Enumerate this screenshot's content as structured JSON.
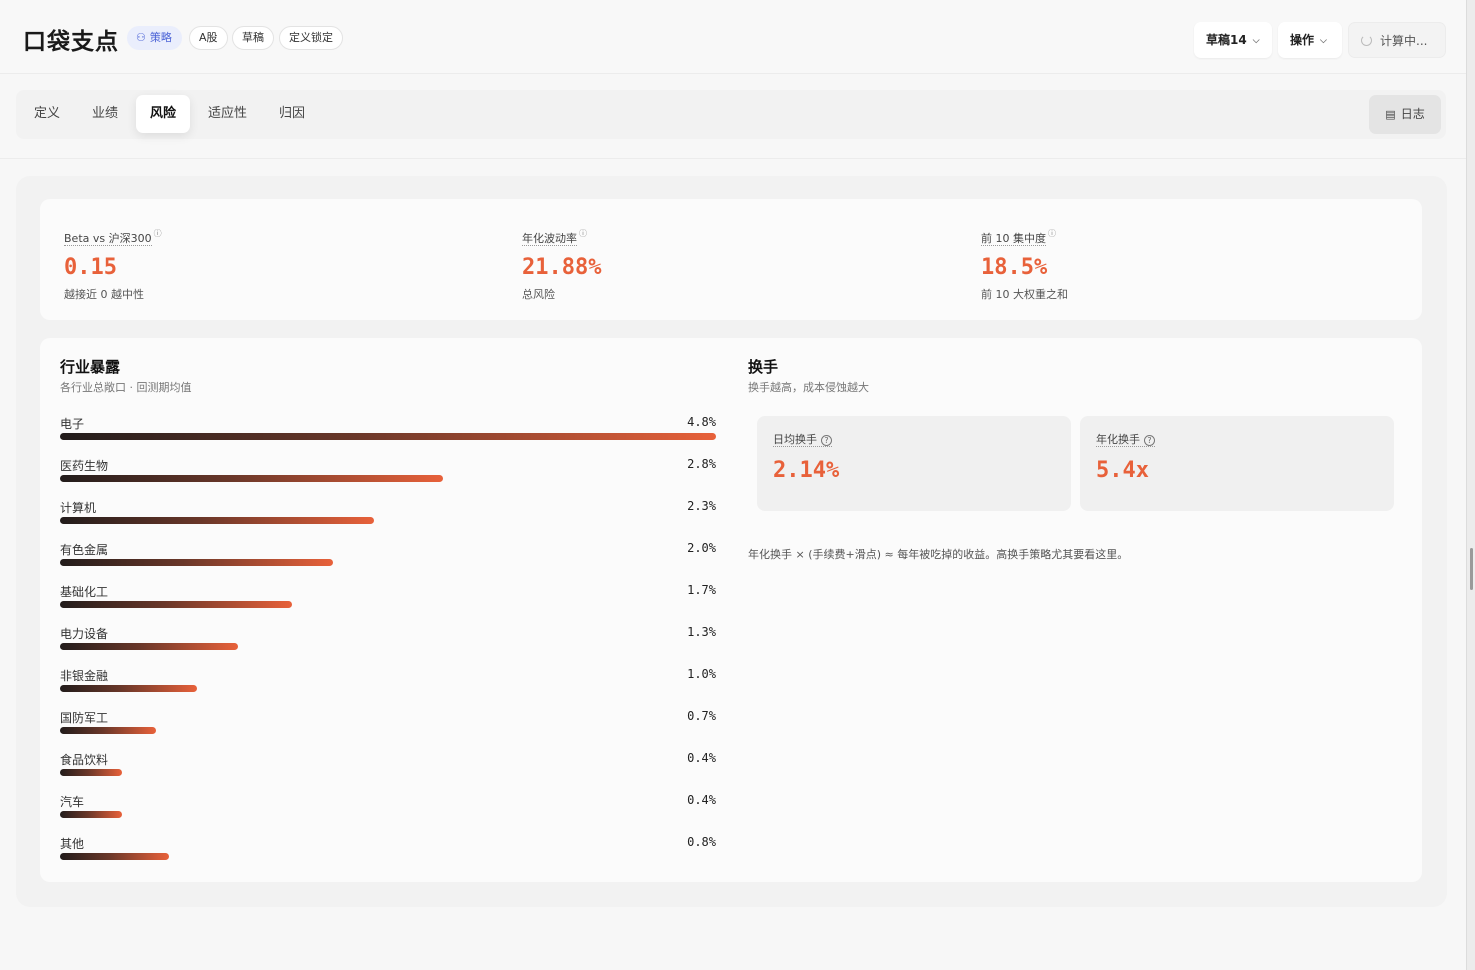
{
  "header": {
    "app_title": "口袋支点",
    "chips": [
      {
        "label": "策略",
        "icon": "strategy-icon"
      },
      {
        "label": "A股"
      },
      {
        "label": "草稿"
      },
      {
        "label": "定义锁定"
      }
    ],
    "draft_select": "草稿14",
    "actions_label": "操作",
    "status_label": "计算中..."
  },
  "tabs": [
    {
      "label": "定义",
      "active": false
    },
    {
      "label": "业绩",
      "active": false
    },
    {
      "label": "风险",
      "active": true
    },
    {
      "label": "适应性",
      "active": false
    },
    {
      "label": "归因",
      "active": false
    }
  ],
  "log_button": "日志",
  "metrics": [
    {
      "label": "Beta vs 沪深300",
      "value": "0.15",
      "sub": "越接近 0 越中性"
    },
    {
      "label": "年化波动率",
      "value": "21.88%",
      "sub": "总风险"
    },
    {
      "label": "前 10 集中度",
      "value": "18.5%",
      "sub": "前 10 大权重之和"
    }
  ],
  "industry": {
    "title": "行业暴露",
    "subtitle": "各行业总敞口 · 回测期均值",
    "max_value": 4.8,
    "items": [
      {
        "name": "电子",
        "value": 4.8,
        "label": "4.8%"
      },
      {
        "name": "医药生物",
        "value": 2.8,
        "label": "2.8%"
      },
      {
        "name": "计算机",
        "value": 2.3,
        "label": "2.3%"
      },
      {
        "name": "有色金属",
        "value": 2.0,
        "label": "2.0%"
      },
      {
        "name": "基础化工",
        "value": 1.7,
        "label": "1.7%"
      },
      {
        "name": "电力设备",
        "value": 1.3,
        "label": "1.3%"
      },
      {
        "name": "非银金融",
        "value": 1.0,
        "label": "1.0%"
      },
      {
        "name": "国防军工",
        "value": 0.7,
        "label": "0.7%"
      },
      {
        "name": "食品饮料",
        "value": 0.4,
        "label": "0.4%"
      },
      {
        "name": "汽车",
        "value": 0.4,
        "label": "0.4%"
      },
      {
        "name": "其他",
        "value": 0.8,
        "label": "0.8%"
      }
    ]
  },
  "turnover": {
    "title": "换手",
    "subtitle": "换手越高，成本侵蚀越大",
    "daily_label": "日均换手",
    "daily_value": "2.14%",
    "annual_label": "年化换手",
    "annual_value": "5.4x",
    "note": "年化换手 × (手续费+滑点) ≈ 每年被吃掉的收益。高换手策略尤其要看这里。"
  },
  "colors": {
    "accent": "#e8613a",
    "bar_dark": "#221c1b",
    "chip_strategy_bg": "#eaeefc",
    "chip_strategy_fg": "#4b63d6"
  }
}
